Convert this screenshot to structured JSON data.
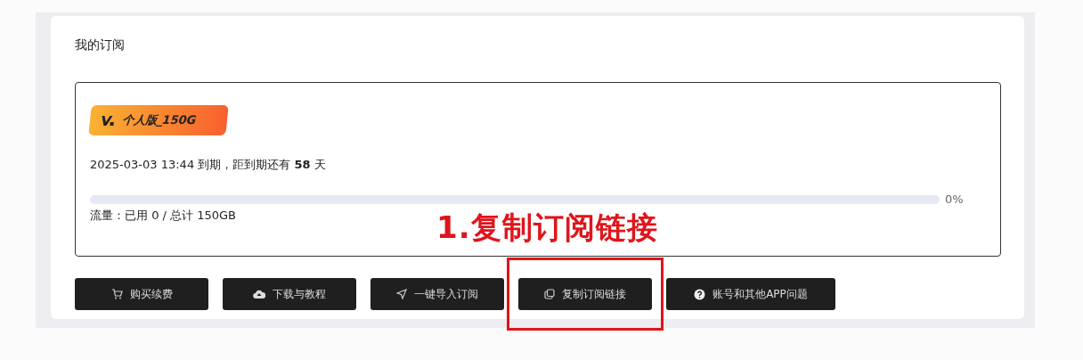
{
  "section_title": "我的订阅",
  "subscription": {
    "plan": "个人版_150G",
    "expiry": "2025-03-03 13:44 到期，距到期还有 **58** 天",
    "usage": {
      "level": 0,
      "reading": "0%"
    },
    "traffic": "流量：已用 0 / 总计 150GB"
  },
  "buttons": [
    {
      "kind": "cart",
      "label": "购买续费",
      "highlighted": false
    },
    {
      "kind": "cloud",
      "label": "下载与教程",
      "highlighted": false
    },
    {
      "kind": "send",
      "label": "一键导入订阅",
      "highlighted": false
    },
    {
      "kind": "copy",
      "label": "复制订阅链接",
      "highlighted": true
    },
    {
      "kind": "help",
      "label": "账号和其他APP问题",
      "highlighted": false
    }
  ],
  "annotation": "1.复制订阅链接"
}
